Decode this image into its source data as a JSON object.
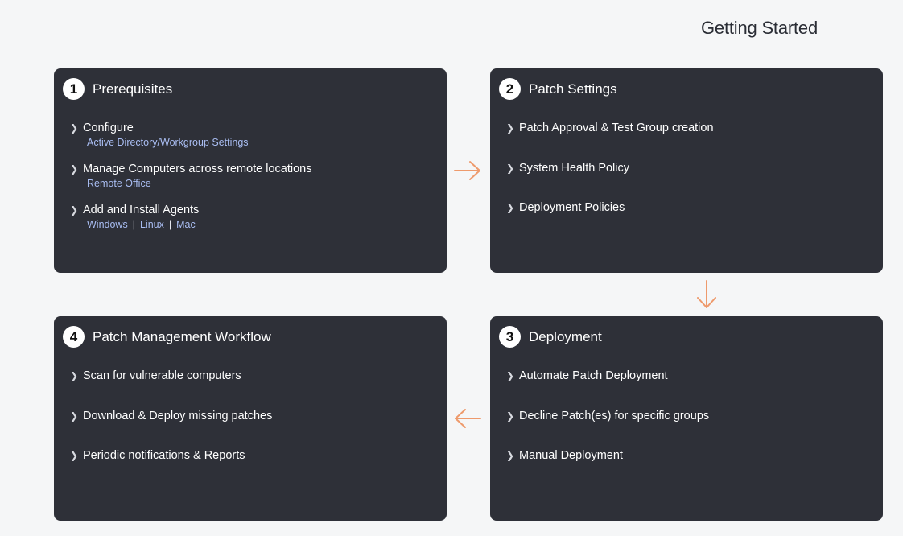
{
  "page": {
    "title": "Getting Started"
  },
  "colors": {
    "background": "#f5f6f7",
    "card": "#2e3038",
    "link": "#a9bdf2",
    "arrow": "#ee9a6c"
  },
  "steps": [
    {
      "number": "1",
      "title": "Prerequisites",
      "items": [
        {
          "label": "Configure",
          "links": [
            "Active Directory/Workgroup Settings"
          ]
        },
        {
          "label": "Manage Computers across remote locations",
          "links": [
            "Remote Office"
          ]
        },
        {
          "label": "Add and Install Agents",
          "links": [
            "Windows",
            "Linux",
            "Mac"
          ],
          "separator": "|"
        }
      ]
    },
    {
      "number": "2",
      "title": "Patch Settings",
      "items": [
        {
          "label": "Patch Approval & Test Group creation"
        },
        {
          "label": "System Health Policy"
        },
        {
          "label": "Deployment Policies"
        }
      ]
    },
    {
      "number": "3",
      "title": "Deployment",
      "items": [
        {
          "label": "Automate Patch Deployment"
        },
        {
          "label": "Decline Patch(es) for specific groups"
        },
        {
          "label": "Manual Deployment"
        }
      ]
    },
    {
      "number": "4",
      "title": "Patch Management Workflow",
      "items": [
        {
          "label": "Scan for vulnerable computers"
        },
        {
          "label": "Download & Deploy missing patches"
        },
        {
          "label": "Periodic notifications & Reports"
        }
      ]
    }
  ],
  "icons": {
    "chevron": "chevron-right-icon",
    "arrow_right": "arrow-right-icon",
    "arrow_down": "arrow-down-icon",
    "arrow_left": "arrow-left-icon"
  }
}
